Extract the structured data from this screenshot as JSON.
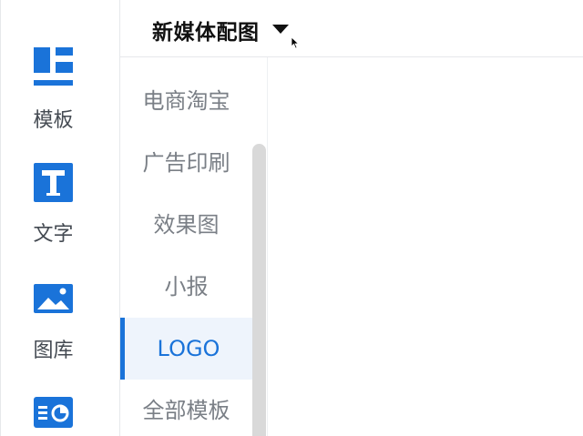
{
  "rail": {
    "items": [
      {
        "label": "模板",
        "icon": "template-icon"
      },
      {
        "label": "文字",
        "icon": "text-icon"
      },
      {
        "label": "图库",
        "icon": "image-icon"
      },
      {
        "label": "",
        "icon": "chart-icon"
      }
    ]
  },
  "header": {
    "title": "新媒体配图"
  },
  "categories": {
    "items": [
      "电商淘宝",
      "广告印刷",
      "效果图",
      "小报",
      "LOGO",
      "全部模板"
    ],
    "active": "LOGO"
  },
  "colors": {
    "accent": "#1a73d9",
    "active_bg": "#eef4fc"
  }
}
